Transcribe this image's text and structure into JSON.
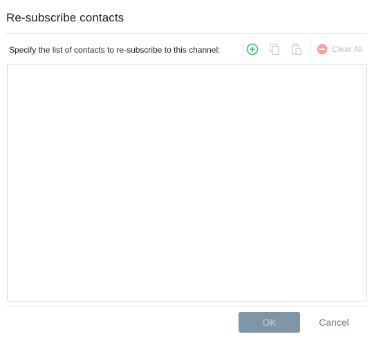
{
  "dialog": {
    "title": "Re-subscribe contacts",
    "instruction": "Specify the list of contacts to re-subscribe to this channel:"
  },
  "toolbar": {
    "add_icon": "plus-circle-icon",
    "copy_icon": "copy-icon",
    "paste_icon": "paste-icon",
    "clear_all_icon": "minus-circle-icon",
    "clear_all_label": "Clear All"
  },
  "contacts": [],
  "footer": {
    "ok_label": "OK",
    "cancel_label": "Cancel"
  },
  "colors": {
    "add_icon": "#2fc26b",
    "disabled": "#c8c8c8",
    "clear_all_icon": "#f2a3a3",
    "ok_background": "#7e95a7"
  }
}
